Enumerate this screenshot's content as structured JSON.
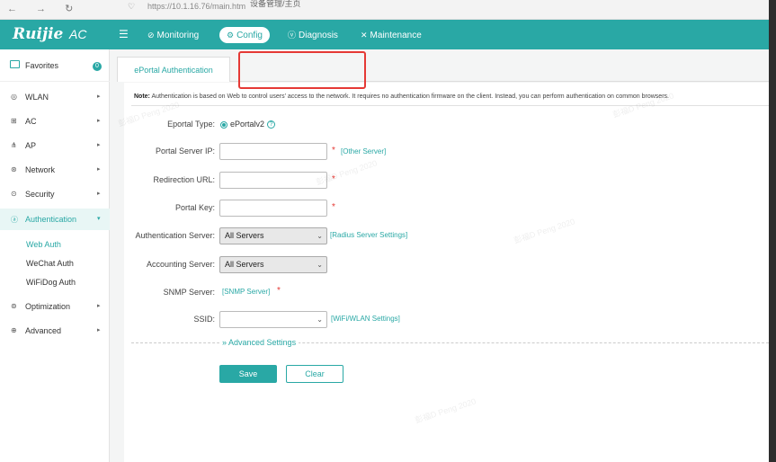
{
  "browser": {
    "nav": "← → ↻",
    "url": "https://10.1.16.76/main.htm",
    "tab_title": "设备管理/主页"
  },
  "header": {
    "logo": "Ruijie",
    "product": "AC",
    "nav": [
      {
        "label": "Monitoring",
        "icon": "monitor-icon"
      },
      {
        "label": "Config",
        "icon": "gear-icon"
      },
      {
        "label": "Diagnosis",
        "icon": "diagnosis-icon"
      },
      {
        "label": "Maintenance",
        "icon": "wrench-icon"
      }
    ],
    "active": "Config"
  },
  "sidebar": {
    "favorites": {
      "label": "Favorites",
      "badge": "0"
    },
    "items": [
      {
        "label": "WLAN"
      },
      {
        "label": "AC"
      },
      {
        "label": "AP"
      },
      {
        "label": "Network"
      },
      {
        "label": "Security"
      },
      {
        "label": "Authentication"
      },
      {
        "label": "Optimization"
      },
      {
        "label": "Advanced"
      }
    ],
    "sub_items": [
      {
        "label": "Web Auth"
      },
      {
        "label": "WeChat Auth"
      },
      {
        "label": "WiFiDog Auth"
      }
    ]
  },
  "main": {
    "tab": "ePortal Authentication",
    "note_prefix": "Note:",
    "note_text": "Authentication is based on Web to control users' access to the network. It requires no authentication firmware on the client. Instead, you can perform authentication on common browsers.",
    "form": {
      "eportal_type": {
        "label": "Eportal Type:",
        "value": "ePortalv2"
      },
      "portal_server_ip": {
        "label": "Portal Server IP:",
        "value": "",
        "link": "[Other Server]"
      },
      "redirection_url": {
        "label": "Redirection URL:",
        "value": ""
      },
      "portal_key": {
        "label": "Portal Key:",
        "value": ""
      },
      "auth_server": {
        "label": "Authentication Server:",
        "value": "All Servers",
        "link": "[Radius Server Settings]"
      },
      "acct_server": {
        "label": "Accounting Server:",
        "value": "All Servers"
      },
      "snmp_server": {
        "label": "SNMP Server:",
        "link": "[SNMP Server]"
      },
      "ssid": {
        "label": "SSID:",
        "value": "",
        "link": "[WiFi/WLAN Settings]"
      },
      "advanced": "Advanced Settings",
      "save": "Save",
      "clear": "Clear"
    },
    "required_mark": "*",
    "help_mark": "?"
  },
  "watermark": "彭福D Peng 2020",
  "colors": {
    "accent": "#29a8a5",
    "required": "#e53935"
  }
}
